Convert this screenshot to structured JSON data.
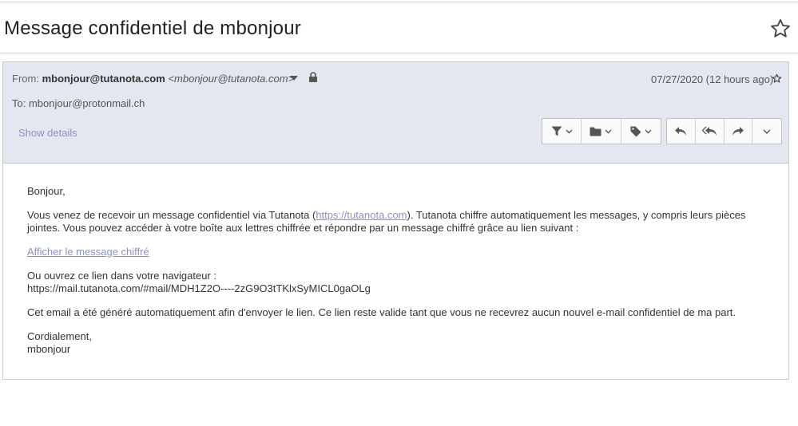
{
  "subject": "Message confidentiel de mbonjour",
  "header": {
    "from_label": "From:",
    "sender_name": "mbonjour@tutanota.com",
    "sender_address": "<mbonjour@tutanota.com>",
    "date": "07/27/2020 (12 hours ago)",
    "to_label": "To:",
    "to_address": "mbonjour@protonmail.ch",
    "show_details": "Show details"
  },
  "icons": {
    "subject_star": "star-outline-icon",
    "sender_menu": "caret-down-icon",
    "encryption": "lock-icon",
    "date_star": "star-outline-icon",
    "actions": [
      "filter-icon",
      "folder-icon",
      "tag-icon",
      "reply-icon",
      "reply-all-icon",
      "forward-icon",
      "more-chevron-icon"
    ]
  },
  "body": {
    "greeting": "Bonjour,",
    "para1_before": "Vous venez de recevoir un message confidentiel via Tutanota (",
    "para1_link": "https://tutanota.com",
    "para1_after": "). Tutanota chiffre automatiquement les messages, y compris leurs pièces jointes. Vous pouvez accéder à votre boîte aux lettres chiffrée et répondre par un message chiffré grâce au lien suivant :",
    "link_label": "Afficher le message chiffré",
    "para2_line1": "Ou ouvrez ce lien dans votre navigateur :",
    "para2_line2": "https://mail.tutanota.com/#mail/MDH1Z2O----2zG9O3tTKlxSyMICL0gaOLg",
    "para3": "Cet email a été généré automatiquement afin d'envoyer le lien. Ce lien reste valide tant que vous ne recevrez aucun nouvel e-mail confidentiel de ma part.",
    "closing": "Cordialement,",
    "signature": "mbonjour"
  },
  "colors": {
    "header_bg": "#e5e7f0",
    "link": "#8a90c8",
    "icon": "#555555"
  }
}
